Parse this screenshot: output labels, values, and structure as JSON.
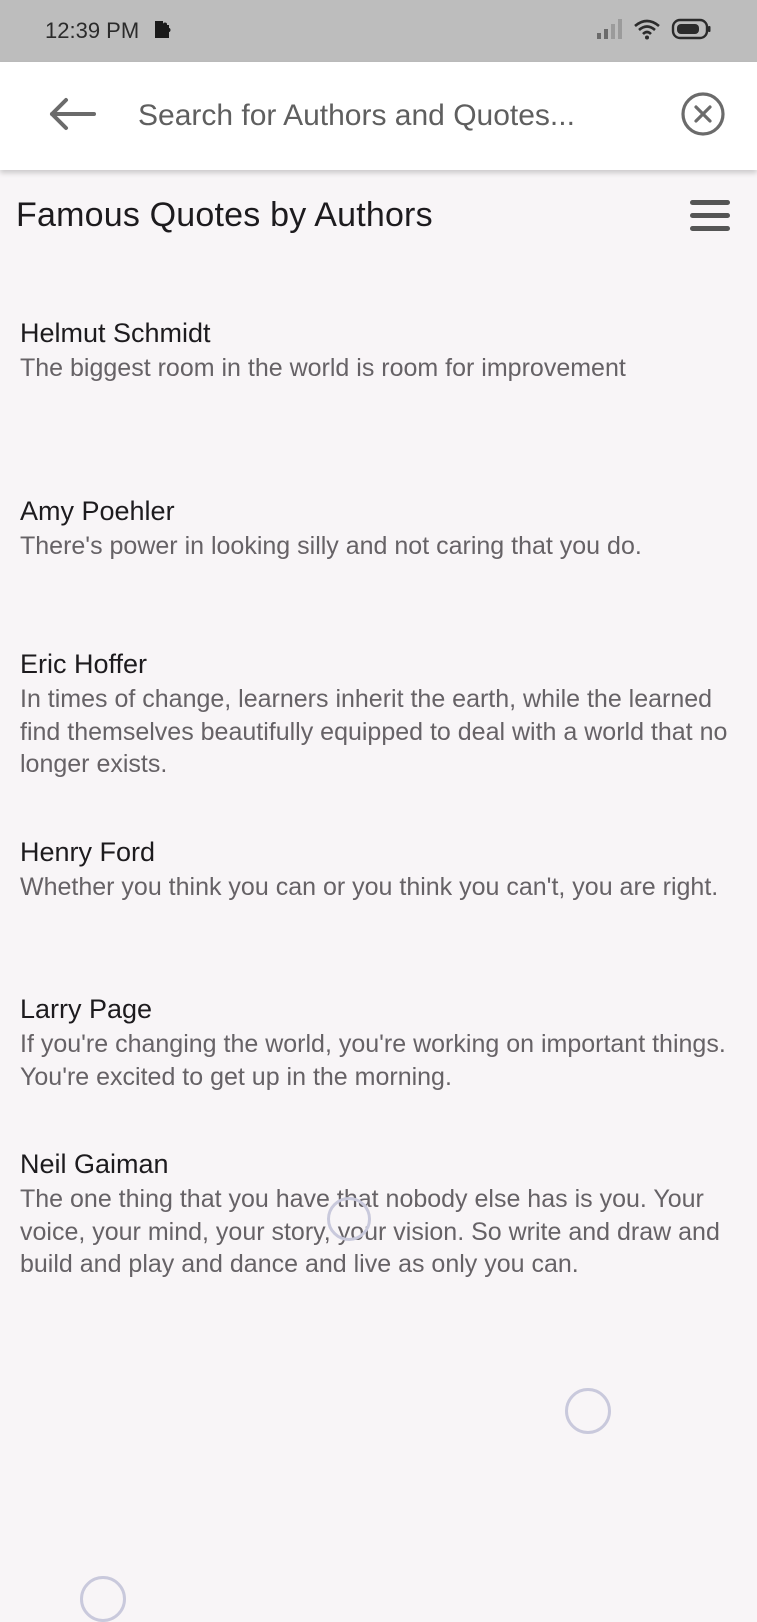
{
  "status_bar": {
    "time": "12:39 PM",
    "battery_level": "74",
    "icons": [
      "notification-icon",
      "signal-icon",
      "wifi-icon",
      "battery-icon"
    ]
  },
  "search": {
    "placeholder": "Search for Authors and Quotes..."
  },
  "header": {
    "title": "Famous Quotes by Authors"
  },
  "quotes": [
    {
      "author": "Helmut Schmidt",
      "text": "The biggest room in the world is room for improvement"
    },
    {
      "author": "Amy Poehler",
      "text": "There's power in looking silly and not caring that you do."
    },
    {
      "author": "Eric Hoffer",
      "text": "In times of change, learners inherit the earth, while the learned find themselves beautifully equipped to deal with a world that no longer exists."
    },
    {
      "author": "Henry Ford",
      "text": "Whether you think you can or you think you can't, you are right."
    },
    {
      "author": "Larry Page",
      "text": "If you're changing the world, you're working on important things. You're excited to get up in the morning."
    },
    {
      "author": "Neil Gaiman",
      "text": "The one thing that you have that nobody else has is you. Your voice, your mind, your story, your vision. So write and draw and build and play and dance and live as only you can."
    }
  ],
  "colors": {
    "status_bar_bg": "#bdbdbd",
    "page_bg": "#f8f5f7",
    "search_bar_bg": "#ffffff",
    "author_text": "#1d1b1e",
    "quote_text": "#666266"
  }
}
